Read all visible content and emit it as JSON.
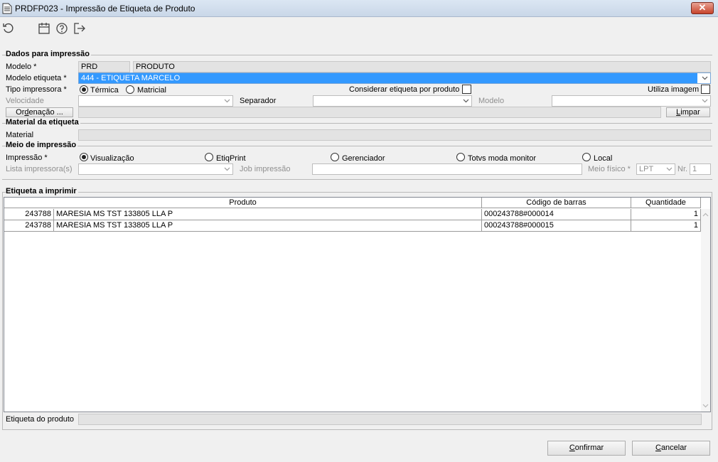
{
  "window": {
    "title": "PRDFP023 - Impressão de Etiqueta de Produto",
    "close": "✕"
  },
  "toolbar": [
    "refresh-icon",
    "calendar-icon",
    "help-icon",
    "exit-icon"
  ],
  "dados": {
    "group_title": "Dados para impressão",
    "modelo_label": "Modelo *",
    "modelo_code": "PRD",
    "modelo_desc": "PRODUTO",
    "modelo_etiqueta_label": "Modelo etiqueta *",
    "modelo_etiqueta_value": "444 - ETIQUETA MARCELO",
    "tipo_impressora_label": "Tipo impressora *",
    "tipo_termica": "Térmica",
    "tipo_matricial": "Matricial",
    "considerar_label": "Considerar etiqueta por produto",
    "utiliza_imagem_label": "Utiliza imagem",
    "velocidade_label": "Velocidade",
    "separador_label": "Separador",
    "modelo2_label": "Modelo",
    "ordenacao_button_pre": "Or",
    "ordenacao_button_u": "d",
    "ordenacao_button_post": "enação ...",
    "limpar_button_u": "L",
    "limpar_button_post": "impar"
  },
  "material": {
    "group_title": "Material da etiqueta",
    "material_label": "Material"
  },
  "meio": {
    "group_title": "Meio de impressão",
    "impressao_label": "Impressão *",
    "opt_visualizacao": "Visualização",
    "opt_etiqprint": "EtiqPrint",
    "opt_gerenciador": "Gerenciador",
    "opt_totvs": "Totvs moda monitor",
    "opt_local": "Local",
    "lista_label": "Lista impressora(s)",
    "job_label": "Job impressão",
    "meio_fisico_label": "Meio físico *",
    "meio_fisico_value": "LPT",
    "nr_label": "Nr.",
    "nr_value": "1"
  },
  "etiquetas": {
    "group_title": "Etiqueta a imprimir",
    "columns": [
      "Produto",
      "Código de barras",
      "Quantidade"
    ],
    "rows": [
      {
        "code": "243788",
        "produto": "MARESIA MS TST 133805 LLA P",
        "barras": "000243788#000014",
        "qtd": "1"
      },
      {
        "code": "243788",
        "produto": "MARESIA MS TST 133805 LLA P",
        "barras": "000243788#000015",
        "qtd": "1"
      }
    ],
    "etiqueta_produto_label": "Etiqueta do produto"
  },
  "footer": {
    "confirmar_u": "C",
    "confirmar_post": "onfirmar",
    "cancelar_u": "C",
    "cancelar_post": "ancelar"
  }
}
